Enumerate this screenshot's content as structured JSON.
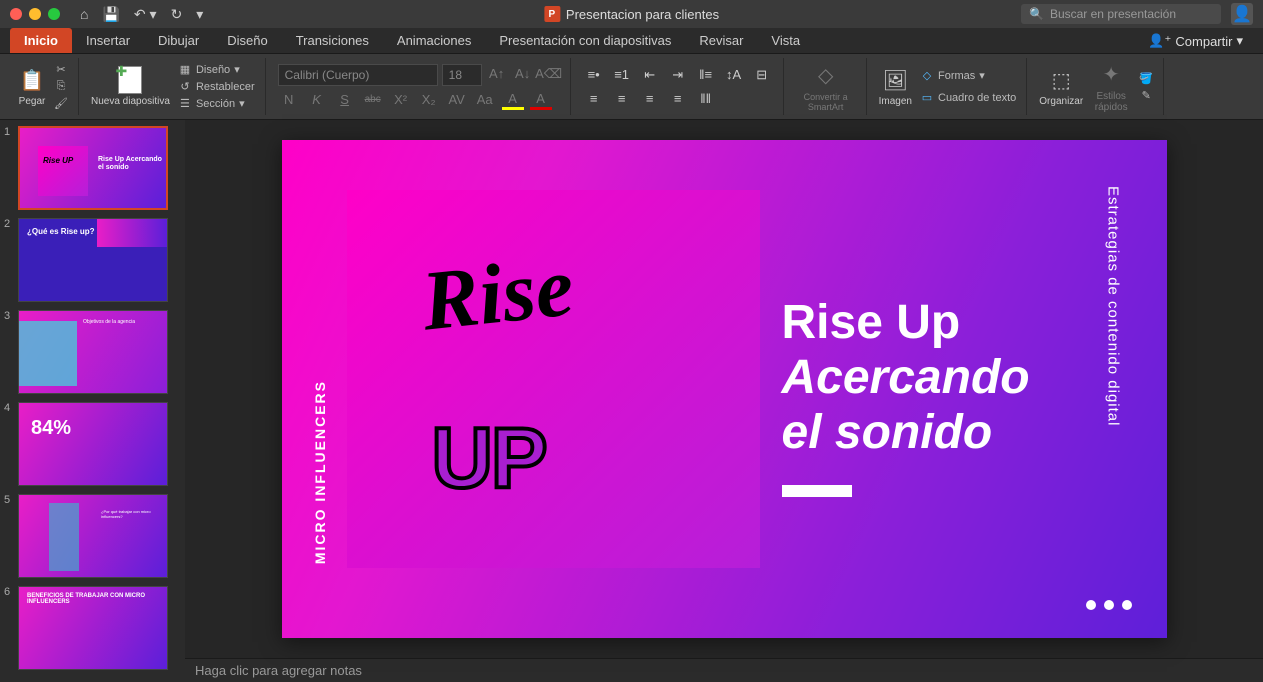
{
  "titlebar": {
    "doc_title": "Presentacion para clientes",
    "search_placeholder": "Buscar en presentación"
  },
  "tabs": {
    "items": [
      "Inicio",
      "Insertar",
      "Dibujar",
      "Diseño",
      "Transiciones",
      "Animaciones",
      "Presentación con diapositivas",
      "Revisar",
      "Vista"
    ],
    "active_index": 0,
    "share_label": "Compartir"
  },
  "ribbon": {
    "paste": "Pegar",
    "new_slide": "Nueva diapositiva",
    "design": "Diseño",
    "reset": "Restablecer",
    "section": "Sección",
    "font_name": "Calibri (Cuerpo)",
    "font_size": "18",
    "bold": "N",
    "italic": "K",
    "underline": "S",
    "strike": "abc",
    "convert_smartart": "Convertir a SmartArt",
    "image": "Imagen",
    "shapes": "Formas",
    "textbox": "Cuadro de texto",
    "arrange": "Organizar",
    "quick_styles": "Estilos rápidos"
  },
  "slide": {
    "side_text": "MICRO INFLUENCERS",
    "right_text": "Estrategias de contenido digital",
    "logo_top": "Rise",
    "logo_bottom": "UP",
    "title_line1": "Rise Up",
    "title_line2": "Acercando",
    "title_line3": "el sonido"
  },
  "thumbnails": [
    {
      "num": "1",
      "title": "Rise Up Acercando el sonido"
    },
    {
      "num": "2",
      "title": "¿Qué es Rise up?"
    },
    {
      "num": "3",
      "title": "Objetivos de la agencia"
    },
    {
      "num": "4",
      "title": "84%"
    },
    {
      "num": "5",
      "title": "¿Por qué trabajar con micro influencers?"
    },
    {
      "num": "6",
      "title": "BENEFICIOS DE TRABAJAR CON MICRO INFLUENCERS"
    }
  ],
  "notes": {
    "placeholder": "Haga clic para agregar notas"
  }
}
